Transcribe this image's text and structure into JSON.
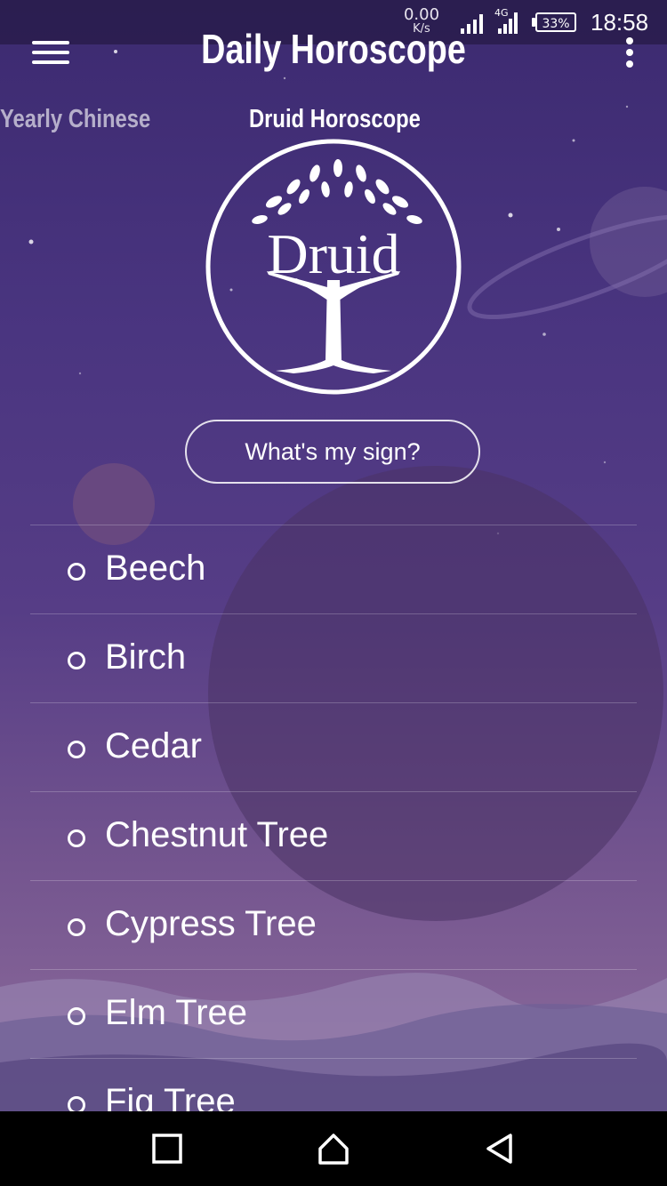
{
  "status_bar": {
    "net_speed_value": "0.00",
    "net_speed_unit": "K/s",
    "network_type": "4G",
    "battery": "33%",
    "time": "18:58"
  },
  "app_bar": {
    "title": "Daily Horoscope",
    "menu_icon": "hamburger-menu-icon",
    "overflow_icon": "more-vert-icon"
  },
  "tabs": [
    {
      "label": "Yearly Chinese",
      "active": false
    },
    {
      "label": "Druid Horoscope",
      "active": true
    }
  ],
  "logo": {
    "text": "Druid",
    "icon": "tree-of-life-icon"
  },
  "sign_button": {
    "label": "What's my sign?"
  },
  "signs": [
    {
      "label": "Beech"
    },
    {
      "label": "Birch"
    },
    {
      "label": "Cedar"
    },
    {
      "label": "Chestnut Tree"
    },
    {
      "label": "Cypress Tree"
    },
    {
      "label": "Elm Tree"
    },
    {
      "label": "Fig Tree"
    }
  ],
  "nav_bar": {
    "recent_icon": "square-icon",
    "home_icon": "home-icon",
    "back_icon": "back-triangle-icon"
  },
  "colors": {
    "background_top": "#3c2a70",
    "background_bottom": "#8e6c9c",
    "text": "#ffffff"
  }
}
